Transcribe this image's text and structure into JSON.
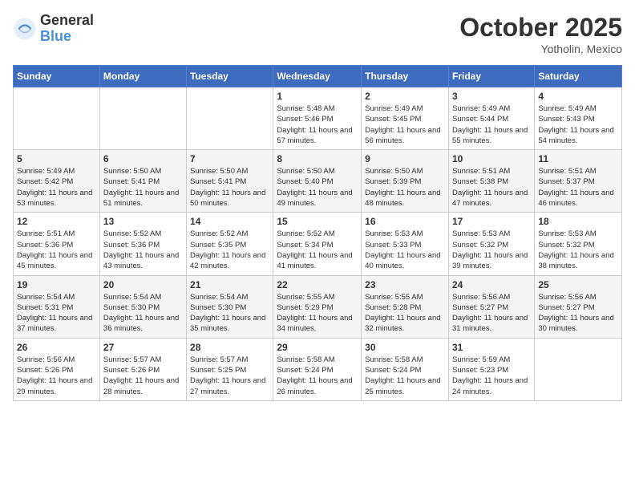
{
  "logo": {
    "general": "General",
    "blue": "Blue"
  },
  "title": "October 2025",
  "subtitle": "Yotholin, Mexico",
  "days_of_week": [
    "Sunday",
    "Monday",
    "Tuesday",
    "Wednesday",
    "Thursday",
    "Friday",
    "Saturday"
  ],
  "weeks": [
    [
      {
        "day": "",
        "info": ""
      },
      {
        "day": "",
        "info": ""
      },
      {
        "day": "",
        "info": ""
      },
      {
        "day": "1",
        "info": "Sunrise: 5:48 AM\nSunset: 5:46 PM\nDaylight: 11 hours\nand 57 minutes."
      },
      {
        "day": "2",
        "info": "Sunrise: 5:49 AM\nSunset: 5:45 PM\nDaylight: 11 hours\nand 56 minutes."
      },
      {
        "day": "3",
        "info": "Sunrise: 5:49 AM\nSunset: 5:44 PM\nDaylight: 11 hours\nand 55 minutes."
      },
      {
        "day": "4",
        "info": "Sunrise: 5:49 AM\nSunset: 5:43 PM\nDaylight: 11 hours\nand 54 minutes."
      }
    ],
    [
      {
        "day": "5",
        "info": "Sunrise: 5:49 AM\nSunset: 5:42 PM\nDaylight: 11 hours\nand 53 minutes."
      },
      {
        "day": "6",
        "info": "Sunrise: 5:50 AM\nSunset: 5:41 PM\nDaylight: 11 hours\nand 51 minutes."
      },
      {
        "day": "7",
        "info": "Sunrise: 5:50 AM\nSunset: 5:41 PM\nDaylight: 11 hours\nand 50 minutes."
      },
      {
        "day": "8",
        "info": "Sunrise: 5:50 AM\nSunset: 5:40 PM\nDaylight: 11 hours\nand 49 minutes."
      },
      {
        "day": "9",
        "info": "Sunrise: 5:50 AM\nSunset: 5:39 PM\nDaylight: 11 hours\nand 48 minutes."
      },
      {
        "day": "10",
        "info": "Sunrise: 5:51 AM\nSunset: 5:38 PM\nDaylight: 11 hours\nand 47 minutes."
      },
      {
        "day": "11",
        "info": "Sunrise: 5:51 AM\nSunset: 5:37 PM\nDaylight: 11 hours\nand 46 minutes."
      }
    ],
    [
      {
        "day": "12",
        "info": "Sunrise: 5:51 AM\nSunset: 5:36 PM\nDaylight: 11 hours\nand 45 minutes."
      },
      {
        "day": "13",
        "info": "Sunrise: 5:52 AM\nSunset: 5:36 PM\nDaylight: 11 hours\nand 43 minutes."
      },
      {
        "day": "14",
        "info": "Sunrise: 5:52 AM\nSunset: 5:35 PM\nDaylight: 11 hours\nand 42 minutes."
      },
      {
        "day": "15",
        "info": "Sunrise: 5:52 AM\nSunset: 5:34 PM\nDaylight: 11 hours\nand 41 minutes."
      },
      {
        "day": "16",
        "info": "Sunrise: 5:53 AM\nSunset: 5:33 PM\nDaylight: 11 hours\nand 40 minutes."
      },
      {
        "day": "17",
        "info": "Sunrise: 5:53 AM\nSunset: 5:32 PM\nDaylight: 11 hours\nand 39 minutes."
      },
      {
        "day": "18",
        "info": "Sunrise: 5:53 AM\nSunset: 5:32 PM\nDaylight: 11 hours\nand 38 minutes."
      }
    ],
    [
      {
        "day": "19",
        "info": "Sunrise: 5:54 AM\nSunset: 5:31 PM\nDaylight: 11 hours\nand 37 minutes."
      },
      {
        "day": "20",
        "info": "Sunrise: 5:54 AM\nSunset: 5:30 PM\nDaylight: 11 hours\nand 36 minutes."
      },
      {
        "day": "21",
        "info": "Sunrise: 5:54 AM\nSunset: 5:30 PM\nDaylight: 11 hours\nand 35 minutes."
      },
      {
        "day": "22",
        "info": "Sunrise: 5:55 AM\nSunset: 5:29 PM\nDaylight: 11 hours\nand 34 minutes."
      },
      {
        "day": "23",
        "info": "Sunrise: 5:55 AM\nSunset: 5:28 PM\nDaylight: 11 hours\nand 32 minutes."
      },
      {
        "day": "24",
        "info": "Sunrise: 5:56 AM\nSunset: 5:27 PM\nDaylight: 11 hours\nand 31 minutes."
      },
      {
        "day": "25",
        "info": "Sunrise: 5:56 AM\nSunset: 5:27 PM\nDaylight: 11 hours\nand 30 minutes."
      }
    ],
    [
      {
        "day": "26",
        "info": "Sunrise: 5:56 AM\nSunset: 5:26 PM\nDaylight: 11 hours\nand 29 minutes."
      },
      {
        "day": "27",
        "info": "Sunrise: 5:57 AM\nSunset: 5:26 PM\nDaylight: 11 hours\nand 28 minutes."
      },
      {
        "day": "28",
        "info": "Sunrise: 5:57 AM\nSunset: 5:25 PM\nDaylight: 11 hours\nand 27 minutes."
      },
      {
        "day": "29",
        "info": "Sunrise: 5:58 AM\nSunset: 5:24 PM\nDaylight: 11 hours\nand 26 minutes."
      },
      {
        "day": "30",
        "info": "Sunrise: 5:58 AM\nSunset: 5:24 PM\nDaylight: 11 hours\nand 25 minutes."
      },
      {
        "day": "31",
        "info": "Sunrise: 5:59 AM\nSunset: 5:23 PM\nDaylight: 11 hours\nand 24 minutes."
      },
      {
        "day": "",
        "info": ""
      }
    ]
  ]
}
